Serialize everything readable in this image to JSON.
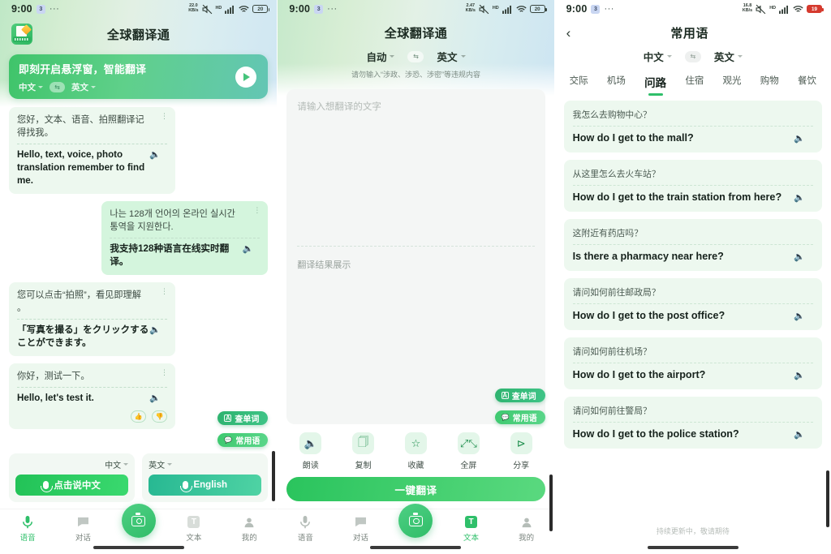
{
  "panel1": {
    "status": {
      "time": "9:00",
      "badge": "3",
      "dots": "···",
      "net_rate": "22.0",
      "net_unit": "KB/s",
      "hd": "HD",
      "battery": "20"
    },
    "app_title": "全球翻译通",
    "app_icon": "translate-app-icon",
    "banner": {
      "title": "即刻开启悬浮窗，智能翻译",
      "source_lang": "中文",
      "target_lang": "英文",
      "swap_icon": "swap-icon",
      "play_icon": "play-icon"
    },
    "messages": [
      {
        "side": "left",
        "src": "您好，文本、语音、拍照翻译记得找我。",
        "dst": "Hello, text, voice, photo translation remember to find me.",
        "rated": false
      },
      {
        "side": "right",
        "src": "나는 128개 언어의 온라인 실시간 통역을 지원한다.",
        "dst": "我支持128种语言在线实时翻译。",
        "rated": false
      },
      {
        "side": "left",
        "src": "您可以点击“拍照”，看见即理解 。",
        "dst": "「写真を撮る」をクリックすることができます。",
        "rated": false
      },
      {
        "side": "left",
        "src": "你好，测试一下。",
        "dst": "Hello, let's test it.",
        "rated": true
      }
    ],
    "chips": [
      {
        "label": "查单词",
        "icon": "dictionary-icon"
      },
      {
        "label": "常用语",
        "icon": "phrasebook-icon"
      }
    ],
    "speak": {
      "left_lang": "中文",
      "left_btn": "点击说中文",
      "right_lang": "英文",
      "right_btn": "English",
      "mic_icon": "microphone-icon"
    },
    "tabs": [
      {
        "label": "语音",
        "icon": "microphone-icon",
        "active": true
      },
      {
        "label": "对话",
        "icon": "chat-icon",
        "active": false
      },
      {
        "label": "",
        "icon": "camera-icon",
        "active": false,
        "center": true
      },
      {
        "label": "文本",
        "icon": "text-icon",
        "active": false
      },
      {
        "label": "我的",
        "icon": "profile-icon",
        "active": false
      }
    ]
  },
  "panel2": {
    "status": {
      "time": "9:00",
      "badge": "3",
      "dots": "···",
      "net_rate": "2.47",
      "net_unit": "KB/s",
      "hd": "HD",
      "battery": "20"
    },
    "app_title": "全球翻译通",
    "source_lang": "自动",
    "target_lang": "英文",
    "warning": "请勿输入“涉政、涉恐、涉密”等违规内容",
    "input_placeholder": "请输入想翻译的文字",
    "input_value": "",
    "result_placeholder": "翻译结果展示",
    "chips": [
      {
        "label": "查单词",
        "icon": "dictionary-icon"
      },
      {
        "label": "常用语",
        "icon": "phrasebook-icon"
      }
    ],
    "actions": [
      {
        "label": "朗读",
        "icon": "speaker-icon"
      },
      {
        "label": "复制",
        "icon": "copy-icon"
      },
      {
        "label": "收藏",
        "icon": "star-icon"
      },
      {
        "label": "全屏",
        "icon": "fullscreen-icon"
      },
      {
        "label": "分享",
        "icon": "share-icon"
      }
    ],
    "cta": "一键翻译",
    "tabs": [
      {
        "label": "语音",
        "icon": "microphone-icon",
        "active": false
      },
      {
        "label": "对话",
        "icon": "chat-icon",
        "active": false
      },
      {
        "label": "",
        "icon": "camera-icon",
        "active": false,
        "center": true
      },
      {
        "label": "文本",
        "icon": "text-icon",
        "active": true
      },
      {
        "label": "我的",
        "icon": "profile-icon",
        "active": false
      }
    ]
  },
  "panel3": {
    "status": {
      "time": "9:00",
      "badge": "3",
      "dots": "···",
      "net_rate": "16.8",
      "net_unit": "KB/s",
      "hd": "HD",
      "battery": "19"
    },
    "back_icon": "back-chevron-icon",
    "title": "常用语",
    "source_lang": "中文",
    "target_lang": "英文",
    "tabs": [
      {
        "label": "交际",
        "active": false
      },
      {
        "label": "机场",
        "active": false
      },
      {
        "label": "问路",
        "active": true
      },
      {
        "label": "住宿",
        "active": false
      },
      {
        "label": "观光",
        "active": false
      },
      {
        "label": "购物",
        "active": false
      },
      {
        "label": "餐饮",
        "active": false
      }
    ],
    "phrases": [
      {
        "src": "我怎么去购物中心？",
        "dst": "How do I get to the mall?"
      },
      {
        "src": "从这里怎么去火车站？",
        "dst": "How do I get to the train station from here?"
      },
      {
        "src": "这附近有药店吗？",
        "dst": "Is there a pharmacy near here?"
      },
      {
        "src": "请问如何前往邮政局？",
        "dst": "How do I get to the post office?"
      },
      {
        "src": "请问如何前往机场？",
        "dst": "How do I get to the airport?"
      },
      {
        "src": "请问如何前往警局？",
        "dst": "How do I get to the police station?"
      }
    ],
    "footer": "持续更新中，敬请期待"
  },
  "colors": {
    "accent": "#2fbf6a",
    "bubble": "#edf8ef",
    "bubble_right": "#d4f5dd",
    "teal": "#27b892"
  }
}
